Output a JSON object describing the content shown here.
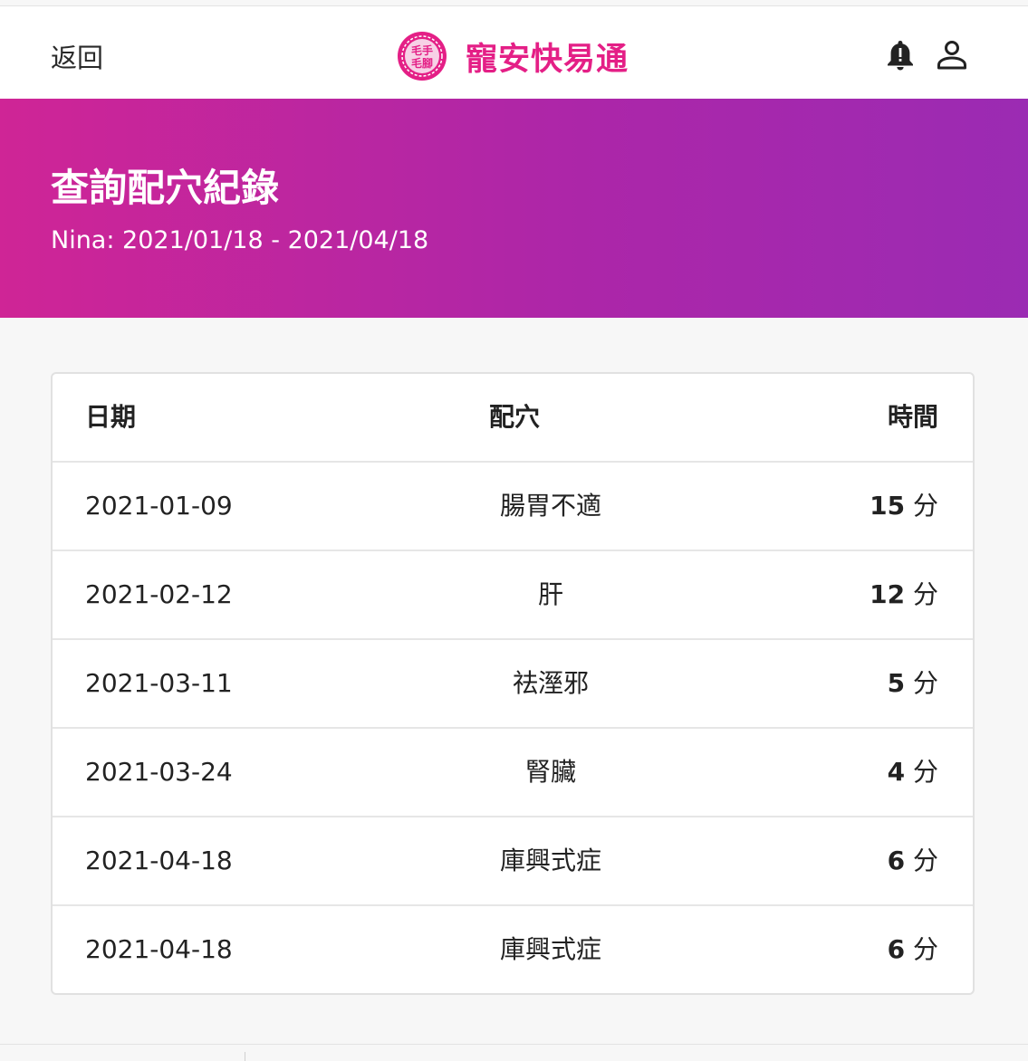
{
  "nav": {
    "back_label": "返回",
    "brand_name": "寵安快易通",
    "logo_text_top": "毛手",
    "logo_text_bottom": "毛腳",
    "icons": [
      "bell-alert-icon",
      "user-icon"
    ]
  },
  "hero": {
    "title": "查詢配穴紀錄",
    "subtitle": "Nina: 2021/01/18 - 2021/04/18"
  },
  "table": {
    "headers": {
      "date": "日期",
      "point": "配穴",
      "time": "時間"
    },
    "unit": "分",
    "rows": [
      {
        "date": "2021-01-09",
        "point": "腸胃不適",
        "minutes": "15"
      },
      {
        "date": "2021-02-12",
        "point": "肝",
        "minutes": "12"
      },
      {
        "date": "2021-03-11",
        "point": "祛溼邪",
        "minutes": "5"
      },
      {
        "date": "2021-03-24",
        "point": "腎臟",
        "minutes": "4"
      },
      {
        "date": "2021-04-18",
        "point": "庫興式症",
        "minutes": "6"
      },
      {
        "date": "2021-04-18",
        "point": "庫興式症",
        "minutes": "6"
      }
    ]
  },
  "colors": {
    "brand": "#e41f86",
    "gradient_start": "#cf2596",
    "gradient_end": "#9b2bb3"
  }
}
